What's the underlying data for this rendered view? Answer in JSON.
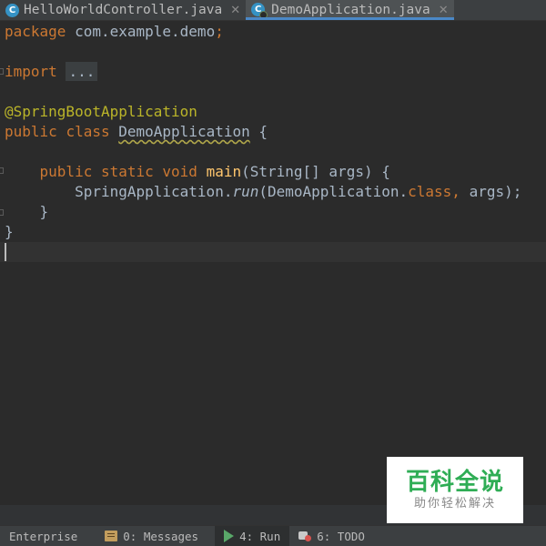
{
  "tabs": [
    {
      "label": "HelloWorldController.java",
      "icon": "class-icon",
      "active": false
    },
    {
      "label": "DemoApplication.java",
      "icon": "spring-boot-class-icon",
      "active": true
    }
  ],
  "editor": {
    "lines": {
      "package_kw": "package",
      "package_name": " com.example.demo",
      "semicolon": ";",
      "import_kw": "import",
      "import_fold": "...",
      "annotation": "@SpringBootApplication",
      "public_kw": "public",
      "class_kw": "class",
      "class_name": "DemoApplication",
      "class_brace": " {",
      "main_indent": "    ",
      "main_mods": "public static void",
      "main_name": "main",
      "main_params": "(String[] args) {",
      "run_indent": "        ",
      "run_obj": "SpringApplication.",
      "run_method": "run",
      "run_args_open": "(DemoApplication.",
      "run_class_kw": "class",
      "run_comma": ",",
      "run_args_close": " args);",
      "close_inner": "    }",
      "close_outer": "}"
    }
  },
  "bottom_bar": [
    {
      "label": "Enterprise"
    },
    {
      "label": "0: Messages"
    },
    {
      "label": "4: Run"
    },
    {
      "label": "6: TODO"
    }
  ],
  "watermark": {
    "title": "百科全说",
    "subtitle": "助你轻松解决"
  },
  "colors": {
    "background": "#2b2b2b",
    "keyword": "#cc7832",
    "annotation": "#bbb529",
    "method": "#ffc66d",
    "text": "#a9b7c6",
    "tab_accent": "#4a88c7",
    "watermark_green": "#2fad55"
  }
}
